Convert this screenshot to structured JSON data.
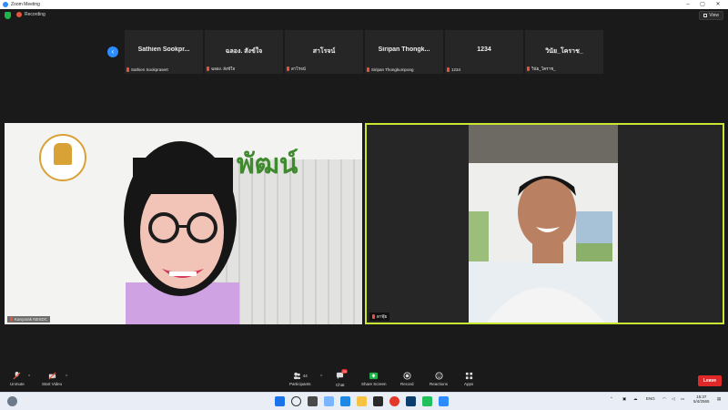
{
  "window": {
    "title": "Zoom Meeting",
    "min_glyph": "–",
    "max_glyph": "▢",
    "close_glyph": "✕"
  },
  "status": {
    "recording": "Recording",
    "view": "View"
  },
  "gallery_strip": [
    {
      "display": "Sathien  Sookpr...",
      "name": "Sathien  Sookprasert"
    },
    {
      "display": "ฉลอง. สังข์ใจ",
      "name": "ฉลอง. สังข์ใจ"
    },
    {
      "display": "สาโรจน์",
      "name": "สาโรจน์"
    },
    {
      "display": "Siripan  Thongk...",
      "name": "Siripan Thongkumpong"
    },
    {
      "display": "1234",
      "name": "1234"
    },
    {
      "display": "วินัย_โคราช_",
      "name": "วินัย_โคราช_"
    }
  ],
  "videos": {
    "left_name": "Kanyarak NESDC",
    "left_logo_text": "พัฒน์",
    "right_name": "ดาฬุ๊ย"
  },
  "controls": {
    "unmute": "Unmute",
    "start_video": "Start Video",
    "participants": "Participants",
    "participant_count": "44",
    "chat": "Chat",
    "chat_badge": "26",
    "share": "Share Screen",
    "record": "Record",
    "reactions": "Reactions",
    "apps": "Apps",
    "leave": "Leave"
  },
  "taskbar": {
    "lang": "ENG",
    "time": "15:37",
    "date": "5/4/2565"
  },
  "colors": {
    "accent": "#2d8cff",
    "leave": "#e02828",
    "share": "#1fb34a",
    "active_border": "#c8e632"
  }
}
